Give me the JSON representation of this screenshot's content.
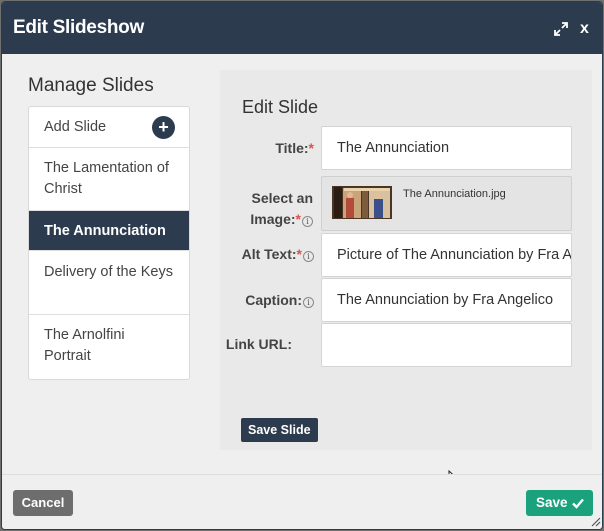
{
  "window": {
    "title": "Edit Slideshow",
    "close_label": "x"
  },
  "manage": {
    "title": "Manage Slides",
    "add_label": "Add Slide",
    "add_icon": "plus-icon",
    "slides": [
      {
        "label": "The Lamentation of Christ"
      },
      {
        "label": "The Annunciation",
        "active": true
      },
      {
        "label": "Delivery of the Keys"
      },
      {
        "label": "The Arnolfini Portrait"
      }
    ]
  },
  "edit": {
    "title": "Edit Slide",
    "title_label": "Title:",
    "title_value": "The Annunciation",
    "image_label_line1": "Select an",
    "image_label_line2": "Image:",
    "image_filename": "The Annunciation.jpg",
    "alt_label": "Alt Text:",
    "alt_value": "Picture of The Annunciation by Fra Angelico",
    "caption_label": "Caption:",
    "caption_value": "The Annunciation by Fra Angelico",
    "link_label": "Link URL:",
    "link_value": "",
    "save_slide_label": "Save Slide",
    "required_mark": "*",
    "info_mark": "i"
  },
  "footer": {
    "cancel_label": "Cancel",
    "save_label": "Save"
  },
  "colors": {
    "header": "#2c3b4d",
    "save": "#1aa27c",
    "cancel": "#6d6d6d",
    "required": "#d9534f"
  }
}
